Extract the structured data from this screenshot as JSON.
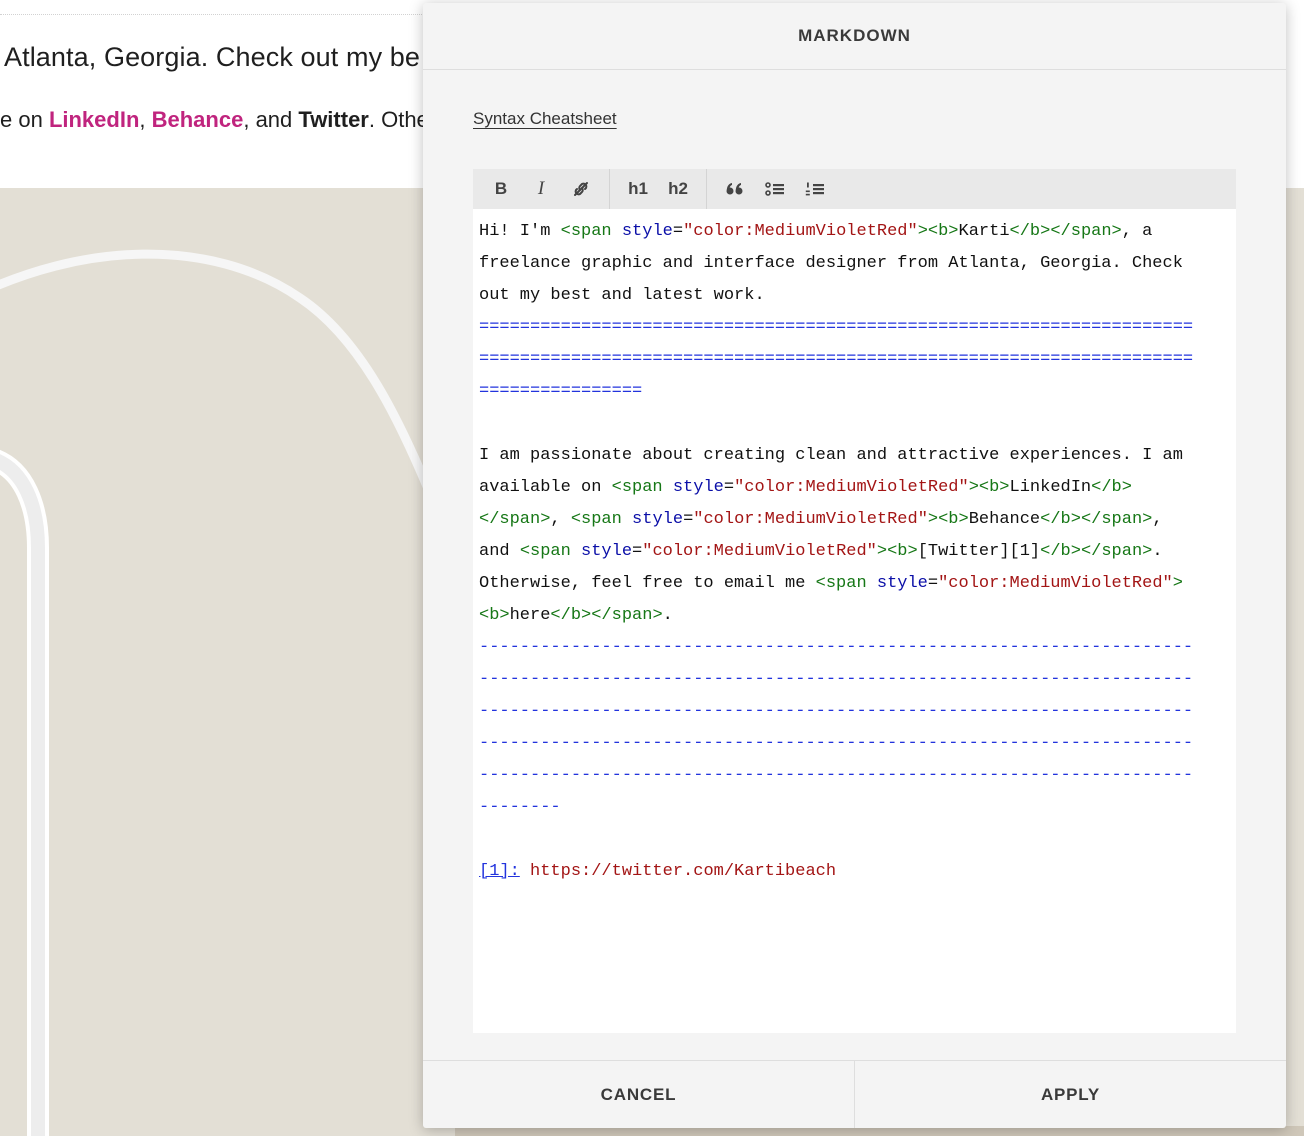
{
  "background": {
    "line1": "Atlanta, Georgia. Check out my be",
    "line2": {
      "prefix": "e on ",
      "link1": "LinkedIn",
      "sep1": ", ",
      "link2": "Behance",
      "sep2": ", and ",
      "bold": "Twitter",
      "suffix": ". Othe"
    },
    "accent_color": "#c0247e",
    "image_color": "#e3dfd5"
  },
  "modal": {
    "title": "MARKDOWN",
    "cheatsheet_label": "Syntax Cheatsheet",
    "toolbar": {
      "bold": "B",
      "italic": "I",
      "link_icon": "link-icon",
      "h1": "h1",
      "h2": "h2",
      "quote_icon": "quote-icon",
      "bullet_icon": "bulleted-list-icon",
      "number_icon": "numbered-list-icon"
    },
    "code": {
      "l1": [
        [
          "t",
          "Hi! I'm "
        ],
        [
          "tag",
          "<span "
        ],
        [
          "att",
          "style"
        ],
        [
          "t",
          "="
        ],
        [
          "str",
          "\"color:MediumVioletRed\""
        ],
        [
          "tag",
          ">"
        ],
        [
          "tag",
          "<b>"
        ],
        [
          "t",
          "Karti"
        ],
        [
          "tag",
          "</b>"
        ],
        [
          "tag",
          "</span>"
        ],
        [
          "t",
          ", a"
        ]
      ],
      "l2": [
        [
          "t",
          "freelance graphic and interface designer from Atlanta, Georgia. Check"
        ]
      ],
      "l3": [
        [
          "t",
          "out my best and latest work."
        ]
      ],
      "l4": [
        [
          "hr",
          "======================================================================"
        ]
      ],
      "l5": [
        [
          "hr",
          "======================================================================"
        ]
      ],
      "l6": [
        [
          "hr",
          "================"
        ]
      ],
      "l7": [
        [
          "t",
          ""
        ]
      ],
      "l8": [
        [
          "t",
          "I am passionate about creating clean and attractive experiences. I am"
        ]
      ],
      "l9": [
        [
          "t",
          "available on "
        ],
        [
          "tag",
          "<span "
        ],
        [
          "att",
          "style"
        ],
        [
          "t",
          "="
        ],
        [
          "str",
          "\"color:MediumVioletRed\""
        ],
        [
          "tag",
          ">"
        ],
        [
          "tag",
          "<b>"
        ],
        [
          "t",
          "LinkedIn"
        ],
        [
          "tag",
          "</b>"
        ]
      ],
      "l10": [
        [
          "tag",
          "</span>"
        ],
        [
          "t",
          ", "
        ],
        [
          "tag",
          "<span "
        ],
        [
          "att",
          "style"
        ],
        [
          "t",
          "="
        ],
        [
          "str",
          "\"color:MediumVioletRed\""
        ],
        [
          "tag",
          ">"
        ],
        [
          "tag",
          "<b>"
        ],
        [
          "t",
          "Behance"
        ],
        [
          "tag",
          "</b>"
        ],
        [
          "tag",
          "</span>"
        ],
        [
          "t",
          ","
        ]
      ],
      "l11": [
        [
          "t",
          "and "
        ],
        [
          "tag",
          "<span "
        ],
        [
          "att",
          "style"
        ],
        [
          "t",
          "="
        ],
        [
          "str",
          "\"color:MediumVioletRed\""
        ],
        [
          "tag",
          ">"
        ],
        [
          "tag",
          "<b>"
        ],
        [
          "t",
          "[Twitter][1]"
        ],
        [
          "tag",
          "</b>"
        ],
        [
          "tag",
          "</span>"
        ],
        [
          "t",
          "."
        ]
      ],
      "l12": [
        [
          "t",
          "Otherwise, feel free to email me "
        ],
        [
          "tag",
          "<span "
        ],
        [
          "att",
          "style"
        ],
        [
          "t",
          "="
        ],
        [
          "str",
          "\"color:MediumVioletRed\""
        ],
        [
          "tag",
          ">"
        ]
      ],
      "l13": [
        [
          "tag",
          "<b>"
        ],
        [
          "t",
          "here"
        ],
        [
          "tag",
          "</b>"
        ],
        [
          "tag",
          "</span>"
        ],
        [
          "t",
          "."
        ]
      ],
      "l14": [
        [
          "hr",
          "----------------------------------------------------------------------"
        ]
      ],
      "l15": [
        [
          "hr",
          "----------------------------------------------------------------------"
        ]
      ],
      "l16": [
        [
          "hr",
          "----------------------------------------------------------------------"
        ]
      ],
      "l17": [
        [
          "hr",
          "----------------------------------------------------------------------"
        ]
      ],
      "l18": [
        [
          "hr",
          "----------------------------------------------------------------------"
        ]
      ],
      "l19": [
        [
          "hr",
          "--------"
        ]
      ],
      "l20": [
        [
          "t",
          ""
        ]
      ],
      "l21": [
        [
          "ref",
          "[1]:"
        ],
        [
          "t",
          " "
        ],
        [
          "url",
          "https://twitter.com/Kartibeach"
        ]
      ]
    },
    "footer": {
      "cancel": "CANCEL",
      "apply": "APPLY"
    }
  }
}
